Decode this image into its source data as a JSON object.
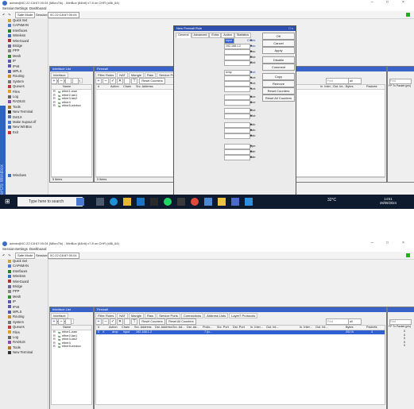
{
  "window": {
    "title": "admin@0C:22:C8:67:00:04 (MikroTik) - WinBox (64bit) v7.8 on CHR (x86_64)",
    "minimize": "–",
    "maximize": "□",
    "close": "×"
  },
  "menu": [
    "Session",
    "Settings",
    "Dashboard"
  ],
  "toolbar": {
    "undo": "↶",
    "redo": "↷",
    "safe_mode": "Safe Mode",
    "session_label": "Session:",
    "session_value": "0C:22:C8:67:00:04"
  },
  "sidebar": {
    "items": [
      "Quick Set",
      "CAPsMAN",
      "Interfaces",
      "Wireless",
      "WireGuard",
      "Bridge",
      "PPP",
      "Mesh",
      "IP",
      "IPv6",
      "MPLS",
      "Routing",
      "System",
      "Queues",
      "Files",
      "Log",
      "RADIUS",
      "Tools",
      "New Terminal",
      "Dot1X",
      "Make Supout.rif",
      "New WinBox",
      "Exit",
      "Windows"
    ],
    "vertical_text": "RouterOS WinBox"
  },
  "interface_list": {
    "title": "Interface List",
    "tabs": [
      "Interface",
      "Interface List",
      "Et"
    ],
    "col_name": "Name",
    "rows": [
      {
        "flag": "R",
        "name": "ether1-wan"
      },
      {
        "flag": "R",
        "name": "ether2-lan1"
      },
      {
        "flag": "R",
        "name": "ether3-lan2"
      },
      {
        "flag": "R",
        "name": "ether4"
      },
      {
        "flag": "R",
        "name": "ether5-winbox"
      }
    ],
    "status": "5 items"
  },
  "firewall": {
    "title": "Firewall",
    "tabs": [
      "Filter Rules",
      "NAT",
      "Mangle",
      "Raw",
      "Service Ports",
      "Connections",
      "Address Lists",
      "Layer7 Protocols"
    ],
    "reset_counters": "Reset Counters",
    "reset_all_counters": "Reset All Counters",
    "find": "Find",
    "find_select": "all",
    "columns": [
      "#",
      "Action",
      "Chain",
      "Src. Address",
      "Dst. Address",
      "Src. Ad...",
      "Dst. Ad...",
      "Proto...",
      "Src. Port",
      "Dst. Port",
      "In. Inter...",
      "Out. Int...",
      "In. Inter...",
      "Out. Int...",
      "Bytes",
      "Packets"
    ],
    "status_top": "0 items",
    "rule_row": {
      "num": "0",
      "flag": "X",
      "action": "drop",
      "chain": "input",
      "src": "192.168.1.2",
      "proto": "7 (ic...",
      "bytes": "252 B",
      "packets": "3"
    }
  },
  "dialog": {
    "title": "New Firewall Rule",
    "tabs": [
      "General",
      "Advanced",
      "Extra",
      "Action",
      "Statistics"
    ],
    "fields": [
      {
        "label": "Chain:",
        "value": "input",
        "blue": true
      },
      {
        "label": "Src. Address:",
        "value": "192.168.1.2",
        "blue": true
      },
      {
        "label": "Dst. Address:",
        "value": "",
        "blue": false
      },
      {
        "label": "Src. Address List:",
        "value": "",
        "blue": false
      },
      {
        "label": "Dst. Address List:",
        "value": "",
        "blue": false
      },
      {
        "label": "Protocol:",
        "value": "icmp",
        "blue": true
      },
      {
        "label": "Src. Port:",
        "value": "",
        "blue": false
      },
      {
        "label": "Dst. Port:",
        "value": "",
        "blue": false
      },
      {
        "label": "Any. Port:",
        "value": "",
        "blue": false
      },
      {
        "label": "In. Interface:",
        "value": "",
        "blue": false
      },
      {
        "label": "Out. Interface:",
        "value": "",
        "blue": false
      },
      {
        "label": "In. Interface List:",
        "value": "",
        "blue": false
      },
      {
        "label": "Out. Interface List:",
        "value": "",
        "blue": false
      },
      {
        "label": "Packet Mark:",
        "value": "",
        "blue": false
      },
      {
        "label": "Connection Mark:",
        "value": "",
        "blue": false
      },
      {
        "label": "Routing Mark:",
        "value": "",
        "blue": false
      },
      {
        "label": "Connection Type:",
        "value": "",
        "blue": false
      },
      {
        "label": "Connection State:",
        "value": "",
        "blue": false
      },
      {
        "label": "Connection NAT State:",
        "value": "",
        "blue": false
      }
    ],
    "buttons": [
      "OK",
      "Cancel",
      "Apply",
      "Disable",
      "Comment",
      "Copy",
      "Remove",
      "Reset Counters",
      "Reset All Counters"
    ],
    "status": "enabled"
  },
  "right_panel": {
    "find": "Find",
    "col1": "FP Tx Packet (p/s)",
    "col2": "FP Rx",
    "zeros": [
      "0",
      "0",
      "0",
      "0",
      "0"
    ]
  },
  "taskbar": {
    "search_placeholder": "Type here to search",
    "weather": "32°C",
    "time": "14:51",
    "date": "28/09/2024"
  },
  "colors": {
    "accent": "#3a63c9",
    "dialog_header": "#2f4fb0",
    "taskbar": "#0e1a2e",
    "led": "#1bb21b",
    "sel_row": "#2f5fd0"
  }
}
